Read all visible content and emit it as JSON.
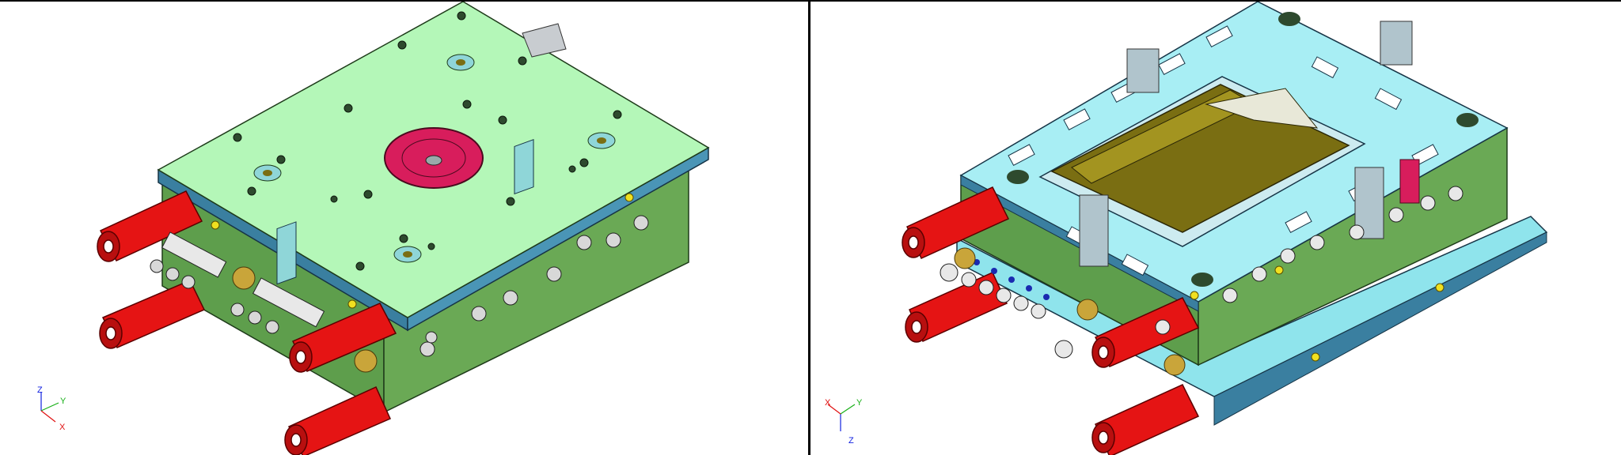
{
  "colors": {
    "background": "#ffffff",
    "divider": "#000000",
    "plate_top_left": "#b4f7b8",
    "plate_side_green": "#5e9e4c",
    "plate_cyan": "#8fe4ec",
    "plate_edge_blue": "#3a7fa0",
    "cylinder_red": "#e51414",
    "sprue_bushing_pink": "#d81d5c",
    "cavity_olive": "#7a6e12",
    "axis_x": "#e01010",
    "axis_y": "#18b018",
    "axis_z": "#1020e0"
  },
  "viewports": [
    {
      "id": "left",
      "description_icon": "mold-assembly-fixed-half-view",
      "triad": {
        "x_label": "X",
        "y_label": "Y",
        "z_label": "Z"
      }
    },
    {
      "id": "right",
      "description_icon": "mold-assembly-moving-half-view",
      "triad": {
        "x_label": "X",
        "y_label": "Y",
        "z_label": "Z"
      }
    }
  ]
}
